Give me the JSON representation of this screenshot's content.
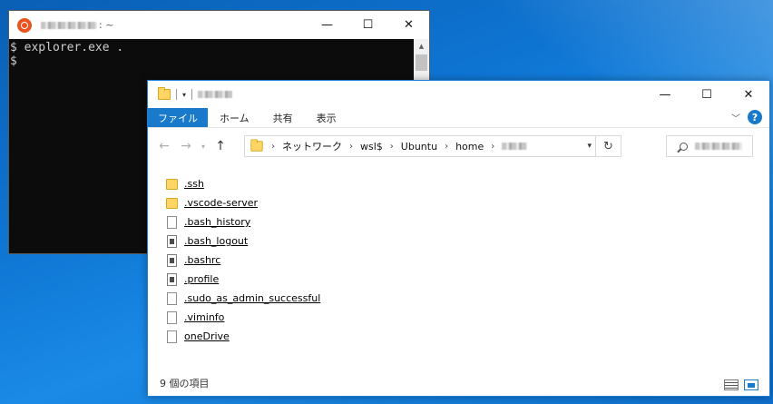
{
  "terminal": {
    "title_suffix": ": ~",
    "lines": [
      "$ explorer.exe .",
      "$"
    ],
    "controls": {
      "minimize": "—",
      "maximize": "☐",
      "close": "✕"
    }
  },
  "explorer": {
    "controls": {
      "minimize": "—",
      "maximize": "☐",
      "close": "✕"
    },
    "ribbon": {
      "tabs": [
        "ファイル",
        "ホーム",
        "共有",
        "表示"
      ],
      "help": "?"
    },
    "address": {
      "crumbs": [
        "ネットワーク",
        "wsl$",
        "Ubuntu",
        "home"
      ]
    },
    "files": [
      {
        "name": ".ssh",
        "type": "folder"
      },
      {
        "name": ".vscode-server",
        "type": "folder"
      },
      {
        "name": ".bash_history",
        "type": "file"
      },
      {
        "name": ".bash_logout",
        "type": "script"
      },
      {
        "name": ".bashrc",
        "type": "script"
      },
      {
        "name": ".profile",
        "type": "script"
      },
      {
        "name": ".sudo_as_admin_successful",
        "type": "file"
      },
      {
        "name": ".viminfo",
        "type": "file"
      },
      {
        "name": "oneDrive",
        "type": "file"
      }
    ],
    "status": "9 個の項目"
  },
  "icons": {
    "ubuntu": "ubuntu-icon",
    "folder": "folder-icon",
    "file": "file-icon",
    "script": "script-file-icon",
    "search": "search-icon",
    "refresh": "refresh-icon",
    "help": "help-icon"
  },
  "colors": {
    "desktop": "#0e74d2",
    "ribbon_file_tab": "#1979ca",
    "terminal_bg": "#0c0c0c",
    "terminal_text": "#cccccc",
    "ubuntu": "#e95420",
    "folder": "#ffd666"
  }
}
